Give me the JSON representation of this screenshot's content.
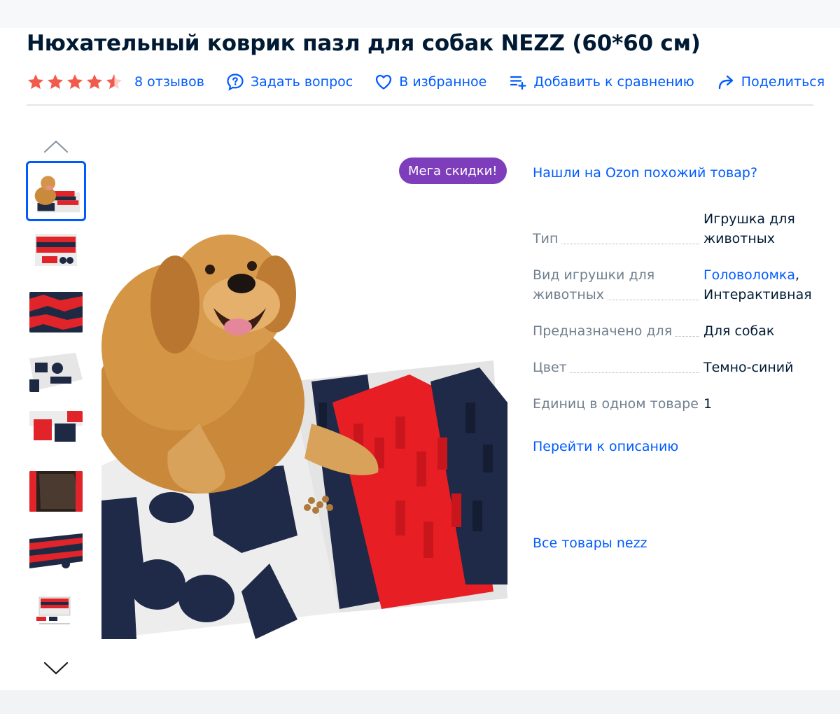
{
  "product": {
    "title": "Нюхательный коврик пазл для собак NEZZ (60*60 см)",
    "rating": 4.5,
    "reviews_label": "8 отзывов"
  },
  "actions": {
    "ask": "Задать вопрос",
    "favorite": "В избранное",
    "compare": "Добавить к сравнению",
    "share": "Поделиться"
  },
  "gallery": {
    "badge": "Мега скидки!",
    "thumb_count": 8,
    "active_index": 0
  },
  "side": {
    "similar_link": "Нашли на Ozon похожий товар?",
    "description_link": "Перейти к описанию",
    "all_products_link": "Все товары nezz"
  },
  "specs": [
    {
      "name": "Тип",
      "value": "Игрушка для животных"
    },
    {
      "name": "Вид игрушки для животных",
      "value_link": "Головоломка",
      "value": ", Интерактивная"
    },
    {
      "name": "Предназначено для",
      "value": "Для собак"
    },
    {
      "name": "Цвет",
      "value": "Темно-синий"
    },
    {
      "name": "Единиц в одном товаре",
      "value": "1"
    }
  ],
  "colors": {
    "accent": "#005bff",
    "badge": "#7e3dbb",
    "star": "#f25b4c",
    "text": "#001a34",
    "muted": "#707f8d"
  }
}
